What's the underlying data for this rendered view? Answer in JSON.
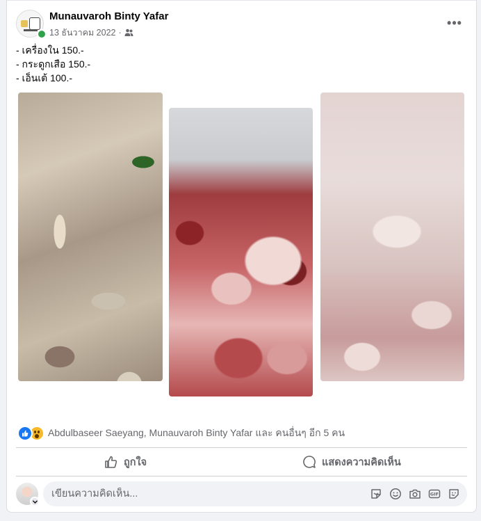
{
  "post": {
    "author": "Munauvaroh Binty Yafar",
    "date": "13 ธันวาคม 2022",
    "separator": "·",
    "audience_icon": "friends-icon",
    "more_label": "•••",
    "lines": [
      "- เครื่องใน 150.-",
      "- กระดูกเสือ 150.-",
      "- เอ็นเต้ 100.-"
    ]
  },
  "reactions": {
    "types": [
      "like",
      "wow"
    ],
    "summary": "Abdulbaseer Saeyang, Munauvaroh Binty Yafar และ คนอื่นๆ อีก 5 คน"
  },
  "actions": {
    "like_label": "ถูกใจ",
    "comment_label": "แสดงความคิดเห็น"
  },
  "comment": {
    "placeholder": "เขียนความคิดเห็น...",
    "icons": [
      "sticker-icon",
      "emoji-icon",
      "camera-icon",
      "gif-icon",
      "avatar-sticker-icon"
    ]
  },
  "colors": {
    "accent": "#1877f2",
    "online": "#31a24c",
    "secondary_text": "#65676b"
  }
}
